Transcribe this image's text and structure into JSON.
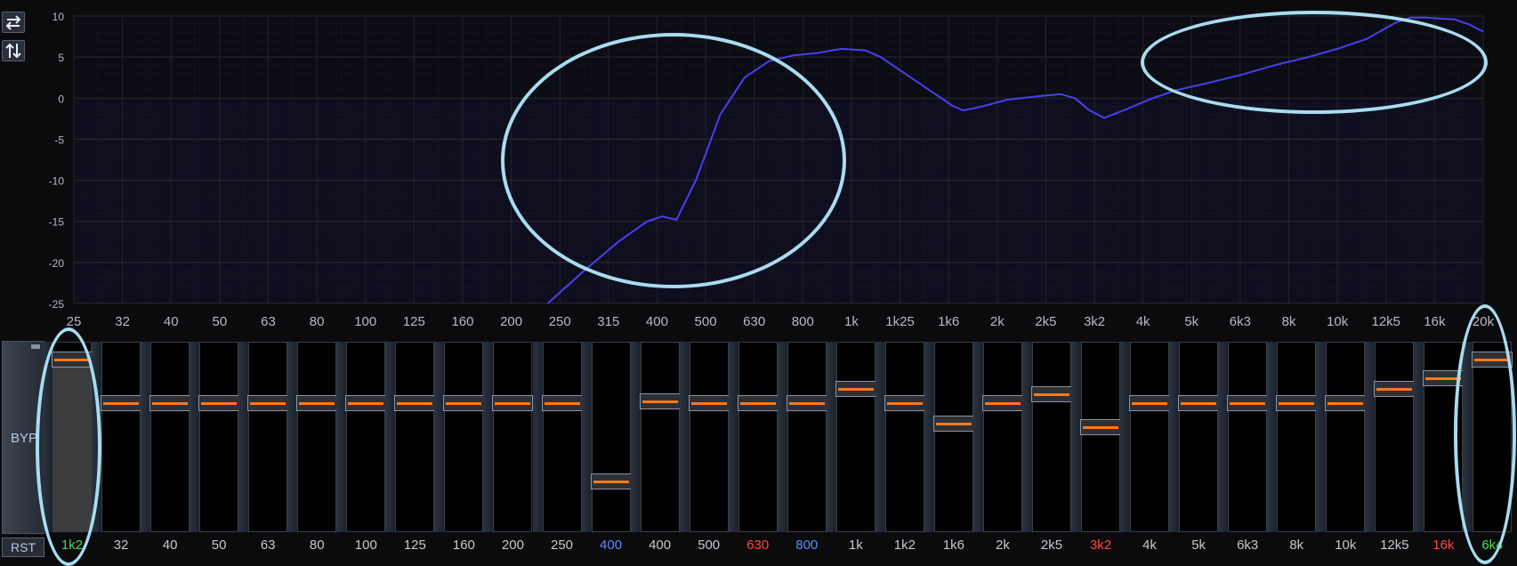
{
  "toolbar": {
    "swap_icon": "swap-horizontal-icon",
    "swap_vertical_icon": "swap-vertical-icon"
  },
  "chart_data": {
    "type": "line",
    "y_ticks": [
      "10",
      "5",
      "0",
      "-5",
      "-10",
      "-15",
      "-20",
      "-25"
    ],
    "ylim": [
      -25,
      10
    ],
    "x_ticks": [
      "25",
      "32",
      "40",
      "50",
      "63",
      "80",
      "100",
      "125",
      "160",
      "200",
      "250",
      "315",
      "400",
      "500",
      "630",
      "800",
      "1k",
      "1k25",
      "1k6",
      "2k",
      "2k5",
      "3k2",
      "4k",
      "5k",
      "6k3",
      "8k",
      "10k",
      "12k5",
      "16k",
      "20k"
    ],
    "xlabel": "",
    "ylabel": "",
    "grid": true,
    "series": [
      {
        "color": "#4a3ff0",
        "x_index": [
          9.75,
          10.5,
          11.2,
          11.8,
          12.1,
          12.4,
          12.8,
          13.3,
          13.8,
          14.3,
          14.8,
          15.3,
          15.8,
          16.3,
          16.6,
          17.1,
          17.6,
          18.1,
          18.3,
          18.7,
          19.2,
          19.8,
          20.3,
          20.6,
          20.9,
          21.2,
          21.6,
          22.2,
          22.7,
          23.3,
          24,
          24.7,
          25.4,
          26,
          26.6,
          27.2,
          27.5,
          27.8,
          28.4,
          28.7,
          29.0
        ],
        "y_db": [
          -25,
          -21,
          -17.5,
          -15,
          -14.4,
          -14.8,
          -10,
          -2,
          2.5,
          4.5,
          5.2,
          5.5,
          6,
          5.8,
          5,
          3,
          1,
          -1,
          -1.5,
          -1,
          -0.2,
          0.2,
          0.5,
          0,
          -1.5,
          -2.4,
          -1.5,
          0,
          1,
          1.8,
          2.8,
          4,
          5,
          6,
          7.2,
          9.2,
          9.8,
          9.8,
          9.6,
          9,
          8.1
        ]
      }
    ]
  },
  "eq": {
    "side": {
      "byp_label": "BYP",
      "rst_label": "RST"
    },
    "bands": [
      {
        "label": "1k2",
        "color": "#4fd84f",
        "level": 0.95,
        "track": 0.93
      },
      {
        "label": "32",
        "color": "#c8c8cc",
        "level": 0.7
      },
      {
        "label": "40",
        "color": "#c8c8cc",
        "level": 0.7
      },
      {
        "label": "50",
        "color": "#c8c8cc",
        "level": 0.7
      },
      {
        "label": "63",
        "color": "#c8c8cc",
        "level": 0.7
      },
      {
        "label": "80",
        "color": "#c8c8cc",
        "level": 0.7
      },
      {
        "label": "100",
        "color": "#c8c8cc",
        "level": 0.7
      },
      {
        "label": "125",
        "color": "#c8c8cc",
        "level": 0.7
      },
      {
        "label": "160",
        "color": "#c8c8cc",
        "level": 0.7
      },
      {
        "label": "200",
        "color": "#c8c8cc",
        "level": 0.7
      },
      {
        "label": "250",
        "color": "#c8c8cc",
        "level": 0.7
      },
      {
        "label": "400",
        "color": "#5a8cff",
        "level": 0.25
      },
      {
        "label": "400",
        "color": "#c8c8cc",
        "level": 0.71
      },
      {
        "label": "500",
        "color": "#c8c8cc",
        "level": 0.7
      },
      {
        "label": "630",
        "color": "#ff4a3a",
        "level": 0.7
      },
      {
        "label": "800",
        "color": "#5a8cff",
        "level": 0.7
      },
      {
        "label": "1k",
        "color": "#c8c8cc",
        "level": 0.78
      },
      {
        "label": "1k2",
        "color": "#c8c8cc",
        "level": 0.7
      },
      {
        "label": "1k6",
        "color": "#c8c8cc",
        "level": 0.58
      },
      {
        "label": "2k",
        "color": "#c8c8cc",
        "level": 0.7
      },
      {
        "label": "2k5",
        "color": "#c8c8cc",
        "level": 0.75
      },
      {
        "label": "3k2",
        "color": "#ff4a3a",
        "level": 0.56
      },
      {
        "label": "4k",
        "color": "#c8c8cc",
        "level": 0.7
      },
      {
        "label": "5k",
        "color": "#c8c8cc",
        "level": 0.7
      },
      {
        "label": "6k3",
        "color": "#c8c8cc",
        "level": 0.7
      },
      {
        "label": "8k",
        "color": "#c8c8cc",
        "level": 0.7
      },
      {
        "label": "10k",
        "color": "#c8c8cc",
        "level": 0.7
      },
      {
        "label": "12k5",
        "color": "#c8c8cc",
        "level": 0.78
      },
      {
        "label": "16k",
        "color": "#ff4a3a",
        "level": 0.84
      },
      {
        "label": "6k4",
        "color": "#4fd84f",
        "level": 0.95
      }
    ]
  },
  "colors": {
    "accent_orange": "#ff7a1a",
    "annotation": "#a8dcf0",
    "curve": "#4a3ff0"
  }
}
